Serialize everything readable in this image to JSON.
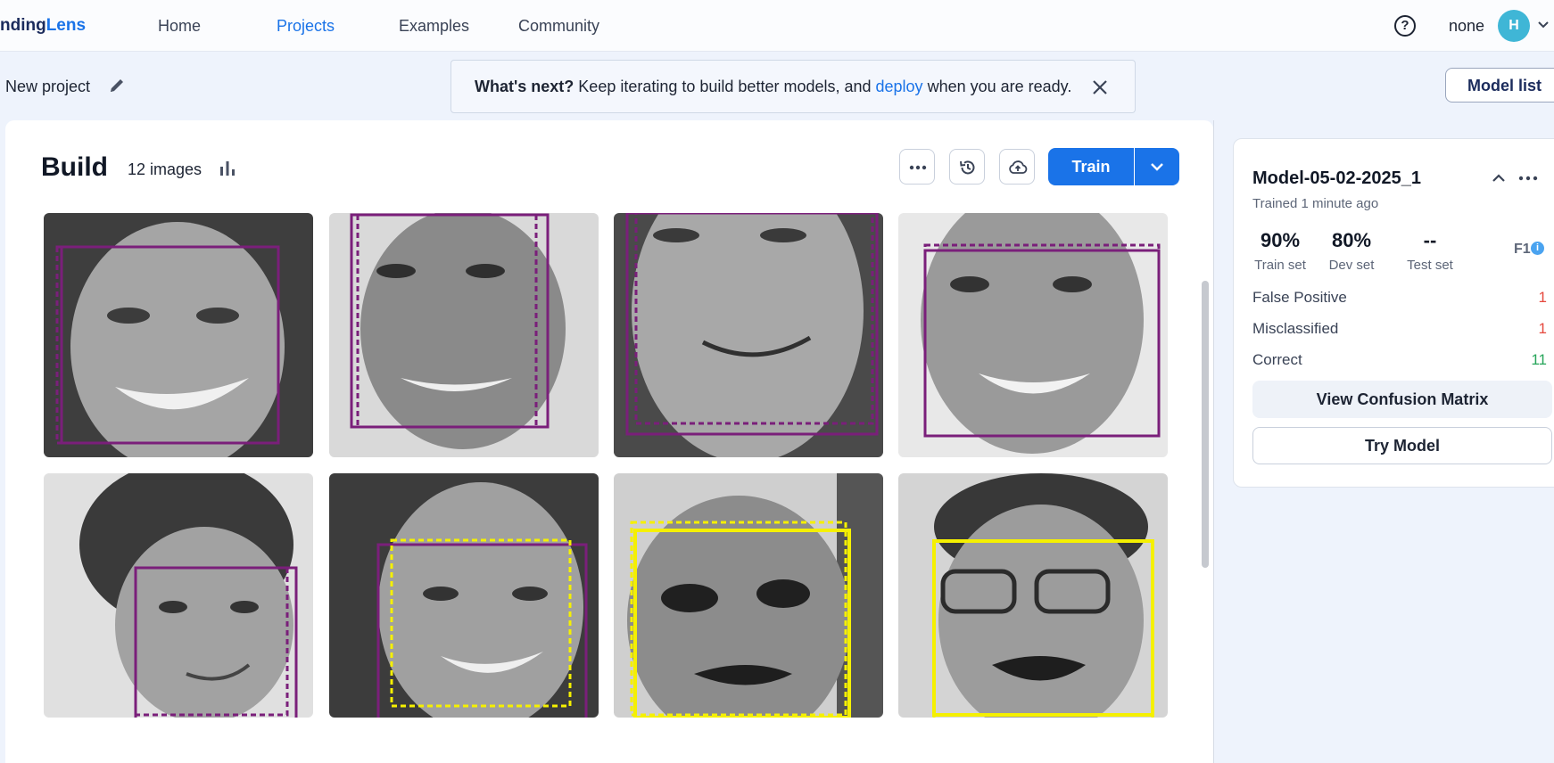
{
  "nav": {
    "logo_part1": "nding",
    "logo_part2": "Lens",
    "items": [
      {
        "label": "Home"
      },
      {
        "label": "Projects"
      },
      {
        "label": "Examples"
      },
      {
        "label": "Community"
      }
    ],
    "help_glyph": "?",
    "username": "none",
    "avatar_initial": "H"
  },
  "project": {
    "name": "New project"
  },
  "notice": {
    "bold": "What's next?",
    "text_before": " Keep iterating to build better models, and ",
    "link": "deploy",
    "text_after": " when you are ready."
  },
  "model_list_label": "Model list",
  "build": {
    "title": "Build",
    "image_count": "12 images",
    "train_label": "Train",
    "images": [
      {
        "label_color": "purple",
        "prediction_color": "purple"
      },
      {
        "label_color": "purple",
        "prediction_color": "purple"
      },
      {
        "label_color": "purple",
        "prediction_color": "purple"
      },
      {
        "label_color": "purple",
        "prediction_color": "purple"
      },
      {
        "label_color": "purple",
        "prediction_color": "purple"
      },
      {
        "label_color": "purple",
        "prediction_color": "yellow"
      },
      {
        "label_color": "yellow",
        "prediction_color": "yellow"
      },
      {
        "label_color": "yellow",
        "prediction_color": "yellow"
      }
    ]
  },
  "model": {
    "name": "Model-05-02-2025_1",
    "trained": "Trained 1 minute ago",
    "metrics": [
      {
        "value": "90%",
        "label": "Train set"
      },
      {
        "value": "80%",
        "label": "Dev set"
      },
      {
        "value": "--",
        "label": "Test set"
      }
    ],
    "metric_type": "F1",
    "stats": [
      {
        "label": "False Positive",
        "count": "1",
        "color": "red"
      },
      {
        "label": "Misclassified",
        "count": "1",
        "color": "red"
      },
      {
        "label": "Correct",
        "count": "11",
        "color": "green"
      }
    ],
    "confusion_label": "View Confusion Matrix",
    "try_label": "Try Model"
  },
  "colors": {
    "accent": "#1a73e8",
    "purple_box": "#7a1f7a",
    "yellow_box": "#f5f000",
    "error": "#e5483e",
    "success": "#27a55a"
  }
}
